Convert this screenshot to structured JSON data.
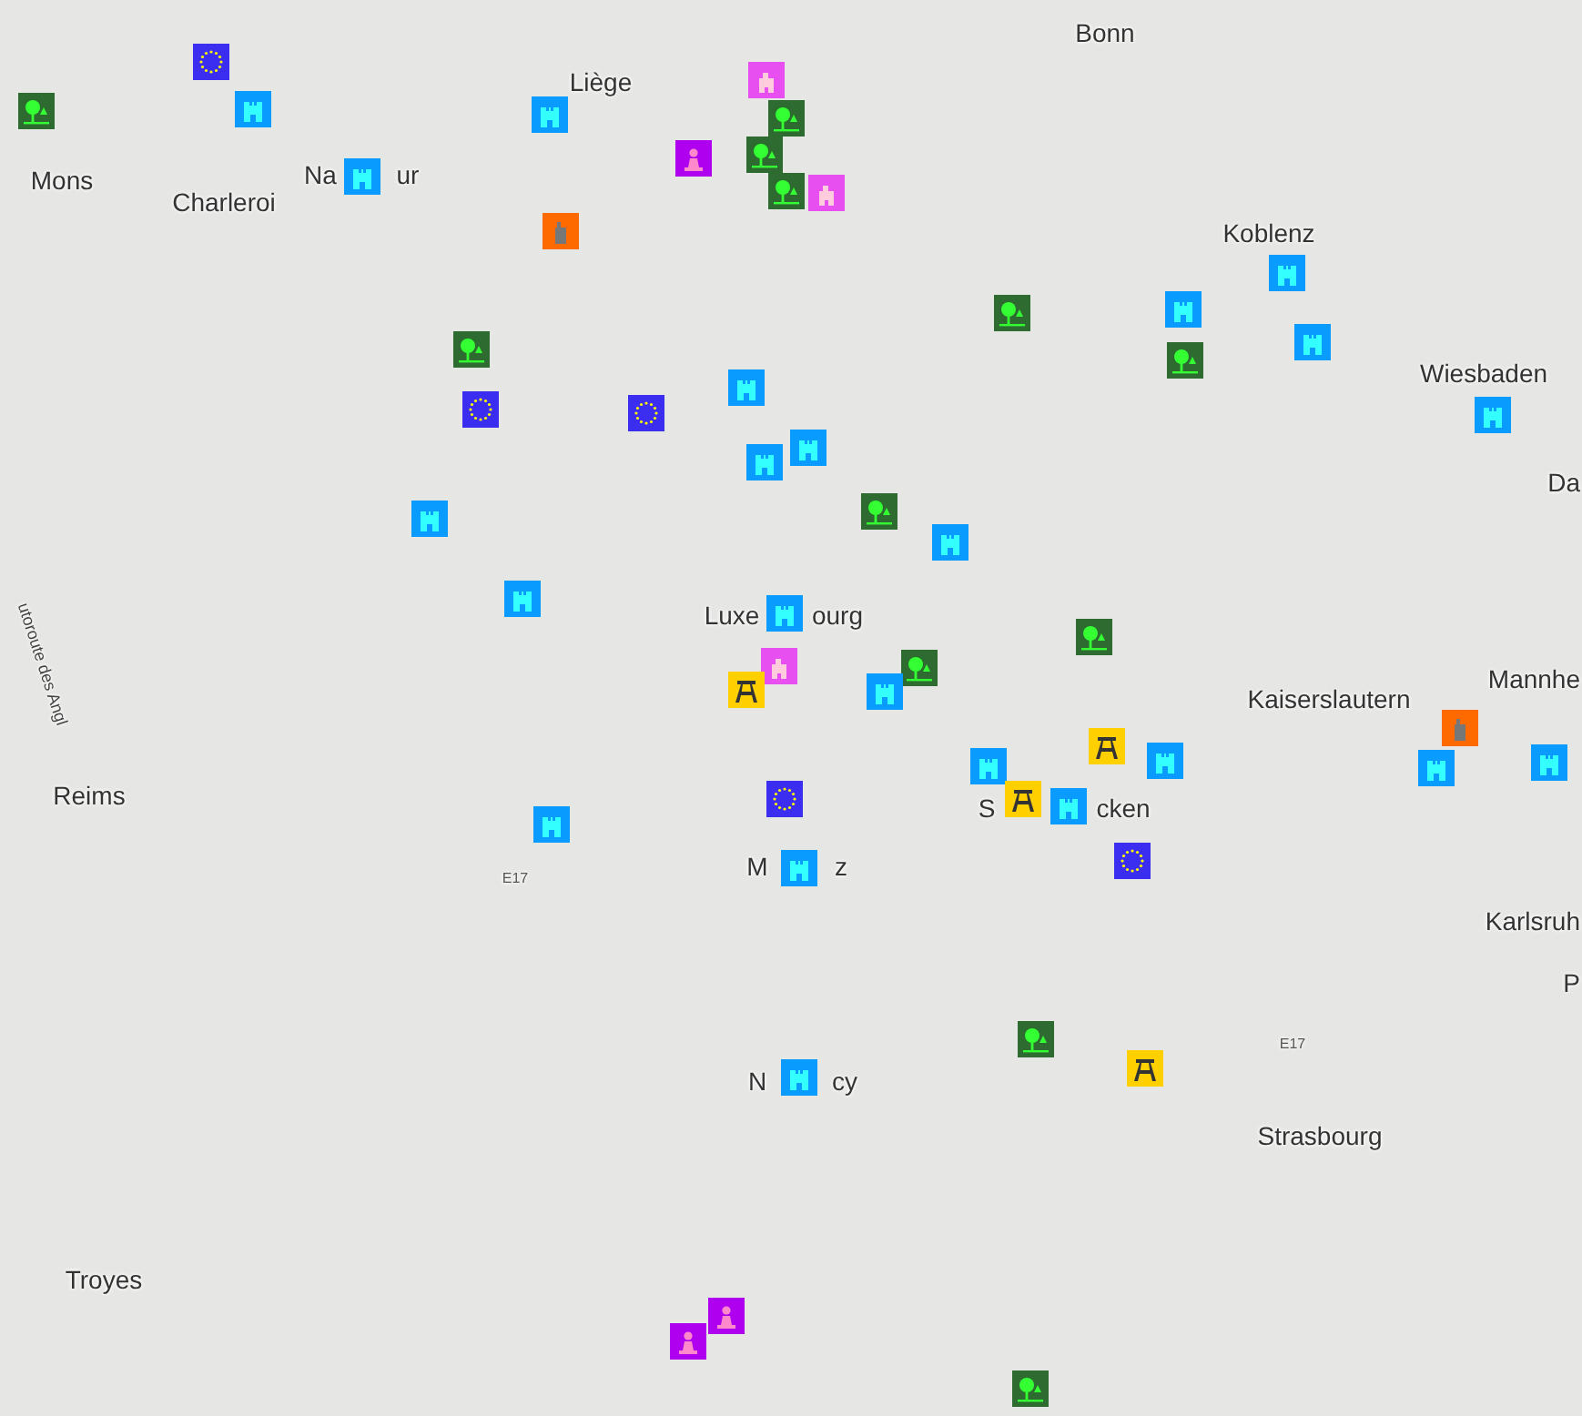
{
  "labels": [
    {
      "text": "Bonn"
    },
    {
      "text": "Liège"
    },
    {
      "text": "Mons"
    },
    {
      "text": "Charleroi"
    },
    {
      "text": "Na"
    },
    {
      "text": "ur"
    },
    {
      "text": "Koblenz"
    },
    {
      "text": "Wiesbaden"
    },
    {
      "text": "Da"
    },
    {
      "text": "Luxe"
    },
    {
      "text": "ourg"
    },
    {
      "text": "Mannhe"
    },
    {
      "text": "Kaiserslautern"
    },
    {
      "text": "Reims"
    },
    {
      "text": "S"
    },
    {
      "text": "cken"
    },
    {
      "text": "M"
    },
    {
      "text": "z"
    },
    {
      "text": "Karlsruh"
    },
    {
      "text": "P"
    },
    {
      "text": "N"
    },
    {
      "text": "cy"
    },
    {
      "text": "Strasbourg"
    },
    {
      "text": "Troyes"
    },
    {
      "text": "E17"
    },
    {
      "text": "E17"
    },
    {
      "text": "utoroute des Angl"
    }
  ],
  "markers": [
    {
      "kind": "park",
      "color": "#2e6b30"
    },
    {
      "kind": "eu",
      "color": "#3b2ef0"
    },
    {
      "kind": "castle",
      "color": "#0a9bff"
    },
    {
      "kind": "castle",
      "color": "#0a9bff"
    },
    {
      "kind": "castle",
      "color": "#0a9bff"
    },
    {
      "kind": "monument",
      "color": "#e84ff0"
    },
    {
      "kind": "park",
      "color": "#2e6b30"
    },
    {
      "kind": "statue",
      "color": "#b000f0"
    },
    {
      "kind": "park",
      "color": "#2e6b30"
    },
    {
      "kind": "park",
      "color": "#2e6b30"
    },
    {
      "kind": "monument",
      "color": "#e84ff0"
    },
    {
      "kind": "museum",
      "color": "#ff6a00"
    },
    {
      "kind": "park",
      "color": "#2e6b30"
    },
    {
      "kind": "park",
      "color": "#2e6b30"
    },
    {
      "kind": "castle",
      "color": "#0a9bff"
    },
    {
      "kind": "castle",
      "color": "#0a9bff"
    },
    {
      "kind": "castle",
      "color": "#0a9bff"
    },
    {
      "kind": "park",
      "color": "#2e6b30"
    },
    {
      "kind": "eu",
      "color": "#3b2ef0"
    },
    {
      "kind": "eu",
      "color": "#3b2ef0"
    },
    {
      "kind": "castle",
      "color": "#0a9bff"
    },
    {
      "kind": "castle",
      "color": "#0a9bff"
    },
    {
      "kind": "castle",
      "color": "#0a9bff"
    },
    {
      "kind": "park",
      "color": "#2e6b30"
    },
    {
      "kind": "castle",
      "color": "#0a9bff"
    },
    {
      "kind": "castle",
      "color": "#0a9bff"
    },
    {
      "kind": "castle",
      "color": "#0a9bff"
    },
    {
      "kind": "castle",
      "color": "#0a9bff"
    },
    {
      "kind": "castle",
      "color": "#0a9bff"
    },
    {
      "kind": "monument",
      "color": "#e84ff0"
    },
    {
      "kind": "mine",
      "color": "#ffd000"
    },
    {
      "kind": "park",
      "color": "#2e6b30"
    },
    {
      "kind": "castle",
      "color": "#0a9bff"
    },
    {
      "kind": "park",
      "color": "#2e6b30"
    },
    {
      "kind": "castle",
      "color": "#0a9bff"
    },
    {
      "kind": "mine",
      "color": "#ffd000"
    },
    {
      "kind": "castle",
      "color": "#0a9bff"
    },
    {
      "kind": "museum",
      "color": "#ff6a00"
    },
    {
      "kind": "castle",
      "color": "#0a9bff"
    },
    {
      "kind": "castle",
      "color": "#0a9bff"
    },
    {
      "kind": "mine",
      "color": "#ffd000"
    },
    {
      "kind": "castle",
      "color": "#0a9bff"
    },
    {
      "kind": "eu",
      "color": "#3b2ef0"
    },
    {
      "kind": "eu",
      "color": "#3b2ef0"
    },
    {
      "kind": "castle",
      "color": "#0a9bff"
    },
    {
      "kind": "castle",
      "color": "#0a9bff"
    },
    {
      "kind": "park",
      "color": "#2e6b30"
    },
    {
      "kind": "mine",
      "color": "#ffd000"
    },
    {
      "kind": "castle",
      "color": "#0a9bff"
    },
    {
      "kind": "statue",
      "color": "#b000f0"
    },
    {
      "kind": "statue",
      "color": "#b000f0"
    },
    {
      "kind": "park",
      "color": "#2e6b30"
    }
  ]
}
